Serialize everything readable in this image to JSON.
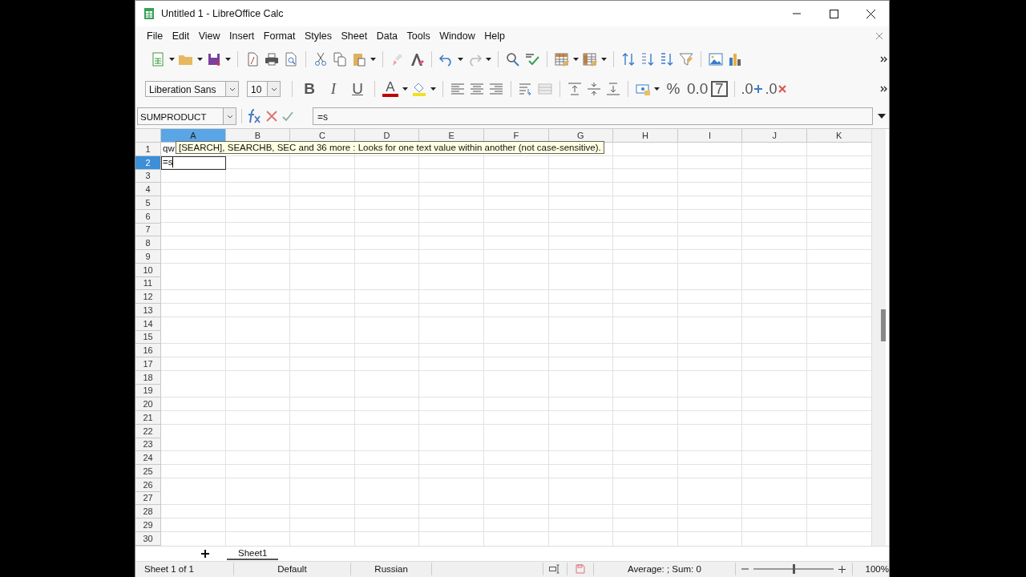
{
  "window": {
    "title": "Untitled 1 - LibreOffice Calc"
  },
  "menu": [
    {
      "label": "File"
    },
    {
      "label": "Edit"
    },
    {
      "label": "View"
    },
    {
      "label": "Insert"
    },
    {
      "label": "Format"
    },
    {
      "label": "Styles"
    },
    {
      "label": "Sheet"
    },
    {
      "label": "Data"
    },
    {
      "label": "Tools"
    },
    {
      "label": "Window"
    },
    {
      "label": "Help"
    }
  ],
  "formatting": {
    "font_name": "Liberation Sans",
    "font_size": "10",
    "bold": "B",
    "italic": "I",
    "underline": "U",
    "font_color": "A",
    "percent": "%",
    "number": "0.0",
    "date": "7",
    "add_decimal": ".0",
    "delete_decimal": ".0"
  },
  "name_box": {
    "value": "SUMPRODUCT"
  },
  "formula": {
    "value": "=s"
  },
  "columns": [
    {
      "label": "A",
      "selected": true
    },
    {
      "label": "B",
      "selected": false
    },
    {
      "label": "C",
      "selected": false
    },
    {
      "label": "D",
      "selected": false
    },
    {
      "label": "E",
      "selected": false
    },
    {
      "label": "F",
      "selected": false
    },
    {
      "label": "G",
      "selected": false
    },
    {
      "label": "H",
      "selected": false
    },
    {
      "label": "I",
      "selected": false
    },
    {
      "label": "J",
      "selected": false
    },
    {
      "label": "K",
      "selected": false
    }
  ],
  "rows": [
    {
      "header": "1",
      "selected": false,
      "cells": [
        {
          "text": "qw",
          "editing": false
        }
      ]
    },
    {
      "header": "2",
      "selected": true,
      "cells": [
        {
          "text": "=s",
          "editing": true
        }
      ]
    },
    {
      "header": "3",
      "selected": false
    },
    {
      "header": "4",
      "selected": false
    },
    {
      "header": "5",
      "selected": false
    },
    {
      "header": "6",
      "selected": false
    },
    {
      "header": "7",
      "selected": false
    },
    {
      "header": "8",
      "selected": false
    },
    {
      "header": "9",
      "selected": false
    },
    {
      "header": "10",
      "selected": false
    },
    {
      "header": "11",
      "selected": false
    },
    {
      "header": "12",
      "selected": false
    },
    {
      "header": "13",
      "selected": false
    },
    {
      "header": "14",
      "selected": false
    },
    {
      "header": "15",
      "selected": false
    },
    {
      "header": "16",
      "selected": false
    },
    {
      "header": "17",
      "selected": false
    },
    {
      "header": "18",
      "selected": false
    },
    {
      "header": "19",
      "selected": false
    },
    {
      "header": "20",
      "selected": false
    },
    {
      "header": "21",
      "selected": false
    },
    {
      "header": "22",
      "selected": false
    },
    {
      "header": "23",
      "selected": false
    },
    {
      "header": "24",
      "selected": false
    },
    {
      "header": "25",
      "selected": false
    },
    {
      "header": "26",
      "selected": false
    },
    {
      "header": "27",
      "selected": false
    },
    {
      "header": "28",
      "selected": false
    },
    {
      "header": "29",
      "selected": false
    },
    {
      "header": "30",
      "selected": false
    }
  ],
  "tooltip": {
    "text": "[SEARCH], SEARCHB, SEC and 36 more : Looks for one text value within another (not case-sensitive)."
  },
  "sheet_tabs": [
    {
      "label": "Sheet1",
      "selected": true
    }
  ],
  "status_bar": {
    "sheet": "Sheet 1 of 1",
    "page_style": "Default",
    "language": "Russian",
    "summary": "Average: ; Sum: 0",
    "zoom_slider": {
      "level": 0.5
    },
    "zoom": "100%"
  }
}
